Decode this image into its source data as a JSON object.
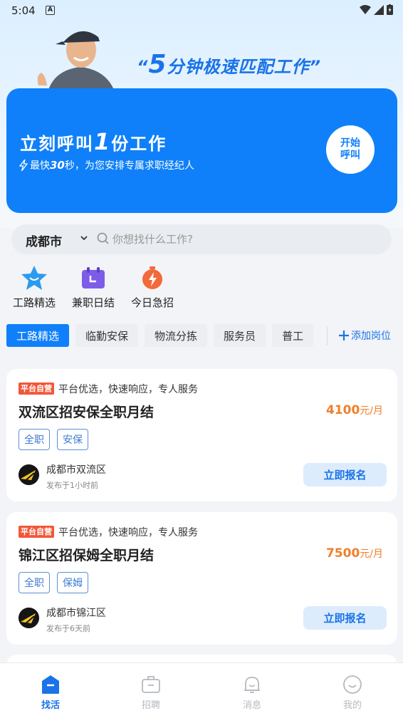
{
  "status_bar": {
    "time": "5:04",
    "badge": "A"
  },
  "hero": {
    "slogan_quote_open": "“",
    "slogan_num": "5",
    "slogan_text": "分钟极速匹配工作",
    "slogan_quote_close": "”"
  },
  "banner": {
    "title_pre": "立刻呼叫",
    "title_num": "1",
    "title_post": "份工作",
    "sub_pre": "最快",
    "sub_num": "30",
    "sub_post": "秒，为您安排专属求职经纪人",
    "call_line1": "开始",
    "call_line2": "呼叫"
  },
  "search": {
    "city": "成都市",
    "placeholder": "你想找什么工作?"
  },
  "quick_categories": [
    {
      "label": "工路精选",
      "icon": "star-icon"
    },
    {
      "label": "兼职日结",
      "icon": "calendar-icon"
    },
    {
      "label": "今日急招",
      "icon": "flash-timer-icon"
    }
  ],
  "filters": [
    "工路精选",
    "临勤安保",
    "物流分拣",
    "服务员",
    "普工"
  ],
  "add_post": "添加岗位",
  "jobs": [
    {
      "badge": "平台自营",
      "promo": "平台优选，快速响应，专人服务",
      "title": "双流区招安保全职月结",
      "salary": "4100",
      "salary_unit": "元/月",
      "tags": [
        "全职",
        "安保"
      ],
      "location": "成都市双流区",
      "posted": "发布于1小时前",
      "apply": "立即报名"
    },
    {
      "badge": "平台自营",
      "promo": "平台优选，快速响应，专人服务",
      "title": "锦江区招保姆全职月结",
      "salary": "7500",
      "salary_unit": "元/月",
      "tags": [
        "全职",
        "保姆"
      ],
      "location": "成都市锦江区",
      "posted": "发布于6天前",
      "apply": "立即报名"
    }
  ],
  "tabbar": [
    {
      "label": "找活",
      "icon": "home-icon",
      "active": true
    },
    {
      "label": "招聘",
      "icon": "briefcase-icon",
      "active": false
    },
    {
      "label": "消息",
      "icon": "bell-icon",
      "active": false
    },
    {
      "label": "我的",
      "icon": "smile-icon",
      "active": false
    }
  ],
  "colors": {
    "primary": "#0f80fa",
    "salary": "#f07f2c",
    "badge": "#f2573a"
  }
}
